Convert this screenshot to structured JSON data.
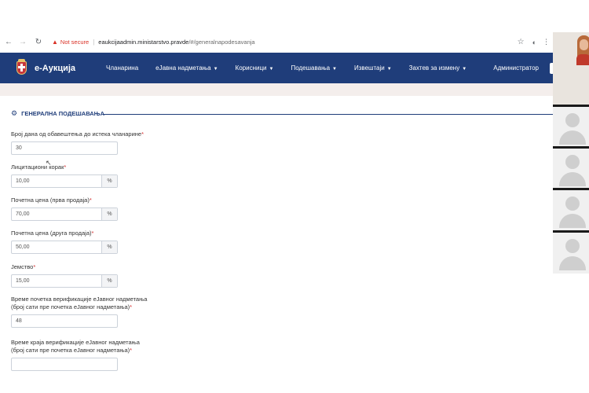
{
  "browser": {
    "security_label": "Not secure",
    "url_host": "eaukcijaadmin.ministarstvo.pravde",
    "url_path": "/#/generalnapodesavanja"
  },
  "navbar": {
    "brand": "е-Аукција",
    "items": [
      {
        "label": "Чланарина",
        "has_caret": false
      },
      {
        "label": "еЈавна надметања",
        "has_caret": true
      },
      {
        "label": "Корисници",
        "has_caret": true
      },
      {
        "label": "Подешавања",
        "has_caret": true
      },
      {
        "label": "Извештаји",
        "has_caret": true
      },
      {
        "label": "Захтев за измену",
        "has_caret": true
      }
    ],
    "user": "Администратор"
  },
  "section": {
    "title": "ГЕНЕРАЛНА ПОДЕШАВАЊА"
  },
  "fields": [
    {
      "label_lines": [
        "Број дана од обавештења до истека чланарине"
      ],
      "value": "30",
      "addon": ""
    },
    {
      "label_lines": [
        "Лицитациони корак"
      ],
      "value": "10,00",
      "addon": "%"
    },
    {
      "label_lines": [
        "Почетна цена (прва продаја)"
      ],
      "value": "70,00",
      "addon": "%"
    },
    {
      "label_lines": [
        "Почетна цена (друга продаја)"
      ],
      "value": "50,00",
      "addon": "%"
    },
    {
      "label_lines": [
        "Јемство"
      ],
      "value": "15,00",
      "addon": "%"
    },
    {
      "label_lines": [
        "Време почетка верификације еЈавног надметања",
        "(број сати пре почетка еЈавног надметања)"
      ],
      "value": "48",
      "addon": ""
    },
    {
      "label_lines": [
        "Време краја верификације еЈавног надметања",
        "(број сати пре почетка еЈавног надметања)"
      ],
      "value": "",
      "addon": ""
    }
  ],
  "required_mark": "*",
  "icons": {
    "back": "arrow-left-icon",
    "forward": "arrow-right-icon",
    "reload": "reload-icon",
    "warning": "warning-icon",
    "bookmark": "star-icon",
    "section": "gear-icon"
  },
  "colors": {
    "navbar": "#1f3d7a",
    "required": "#d32f2f",
    "warning": "#d93025"
  }
}
